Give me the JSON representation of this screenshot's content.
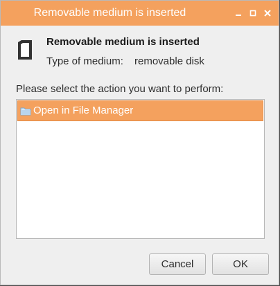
{
  "window": {
    "title": "Removable medium is inserted",
    "controls": [
      "minimize-icon",
      "maximize-icon",
      "close-icon"
    ]
  },
  "header": {
    "icon": "removable-disk-icon",
    "title": "Removable medium is inserted",
    "medium_label": "Type of medium:",
    "medium_value": "removable disk"
  },
  "prompt": "Please select the action you want to perform:",
  "actions": [
    {
      "icon": "folder-icon",
      "label": "Open in File Manager",
      "selected": true
    }
  ],
  "buttons": {
    "cancel": "Cancel",
    "ok": "OK"
  },
  "colors": {
    "accent": "#f4a15e",
    "dialog_background": "#efefef"
  }
}
